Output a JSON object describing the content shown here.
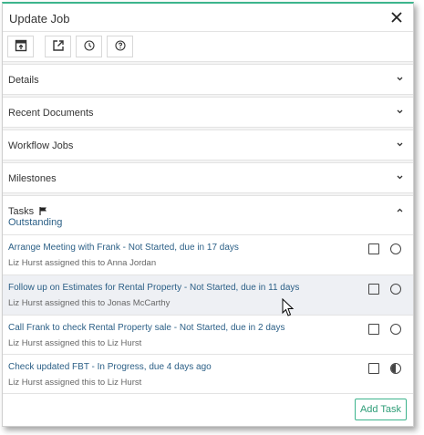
{
  "header": {
    "title": "Update Job",
    "close_icon": "close-icon"
  },
  "toolbar": {
    "icons": [
      "open-in-window-icon",
      "external-link-icon",
      "clock-icon",
      "help-icon"
    ]
  },
  "sections": [
    {
      "label": "Details"
    },
    {
      "label": "Recent Documents"
    },
    {
      "label": "Workflow Jobs"
    },
    {
      "label": "Milestones"
    }
  ],
  "tasks_section": {
    "label": "Tasks",
    "flag_icon": "flag-icon",
    "outstanding_label": "Outstanding"
  },
  "tasks": [
    {
      "title": "Arrange Meeting with Frank - Not Started, due in 17 days",
      "assigned": "Liz Hurst assigned this to Anna Jordan",
      "status": "not-started"
    },
    {
      "title": "Follow up on Estimates for Rental Property - Not Started, due in 11 days",
      "assigned": "Liz Hurst assigned this to Jonas McCarthy",
      "status": "not-started"
    },
    {
      "title": "Call Frank to check Rental Property sale - Not Started, due in 2 days",
      "assigned": "Liz Hurst assigned this to Liz Hurst",
      "status": "not-started"
    },
    {
      "title": "Check updated FBT - In Progress, due 4 days ago",
      "assigned": "Liz Hurst assigned this to Liz Hurst",
      "status": "in-progress"
    }
  ],
  "footer": {
    "add_task_label": "Add Task"
  },
  "colors": {
    "accent": "#3cb48c",
    "link": "#2b5f86"
  }
}
